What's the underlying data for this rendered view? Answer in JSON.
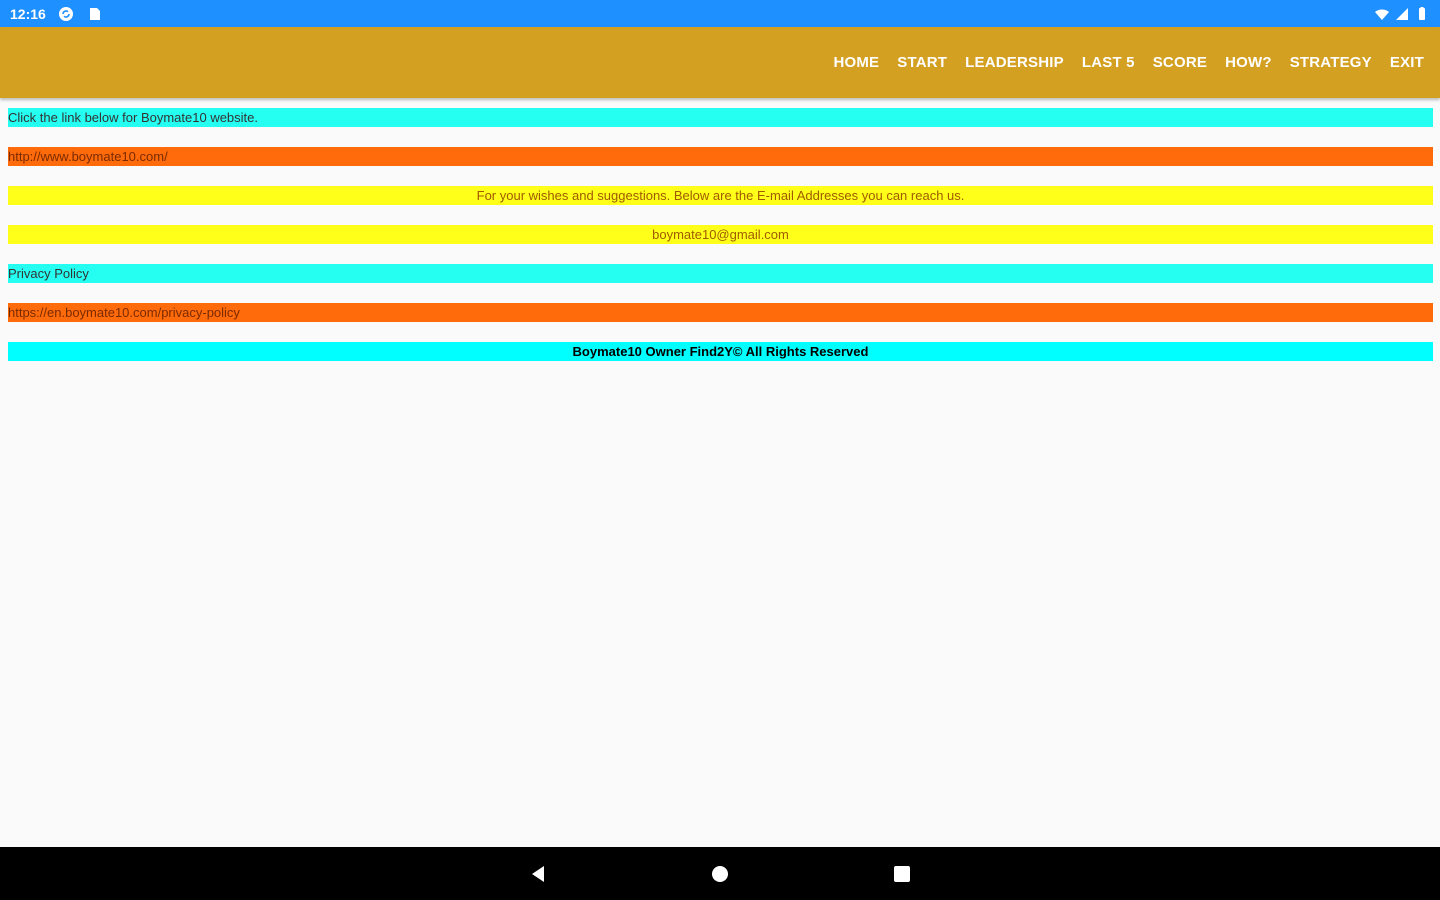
{
  "status_bar": {
    "time": "12:16",
    "icons_left": [
      "sync-icon",
      "sd-card-icon"
    ],
    "icons_right": [
      "wifi-icon",
      "signal-icon",
      "battery-icon"
    ]
  },
  "app_bar": {
    "menu": [
      "HOME",
      "START",
      "LEADERSHIP",
      "LAST 5",
      "SCORE",
      "HOW?",
      "STRATEGY",
      "EXIT"
    ]
  },
  "content": {
    "website_prompt": "Click the link below for Boymate10 website.",
    "website_url": "http://www.boymate10.com/",
    "contact_prompt": "For your wishes and suggestions. Below are the E-mail Addresses you can reach us.",
    "email": "boymate10@gmail.com",
    "privacy_label": "Privacy Policy",
    "privacy_url": "https://en.boymate10.com/privacy-policy",
    "copyright": "Boymate10 Owner Find2Y© All Rights Reserved"
  },
  "colors": {
    "status_bar": "#1e90ff",
    "app_bar": "#d4a021",
    "cyan": "#24fff2",
    "orange": "#ff6a0a",
    "yellow": "#ffff1a"
  },
  "nav_buttons": [
    "back-icon",
    "home-icon",
    "recents-icon"
  ]
}
